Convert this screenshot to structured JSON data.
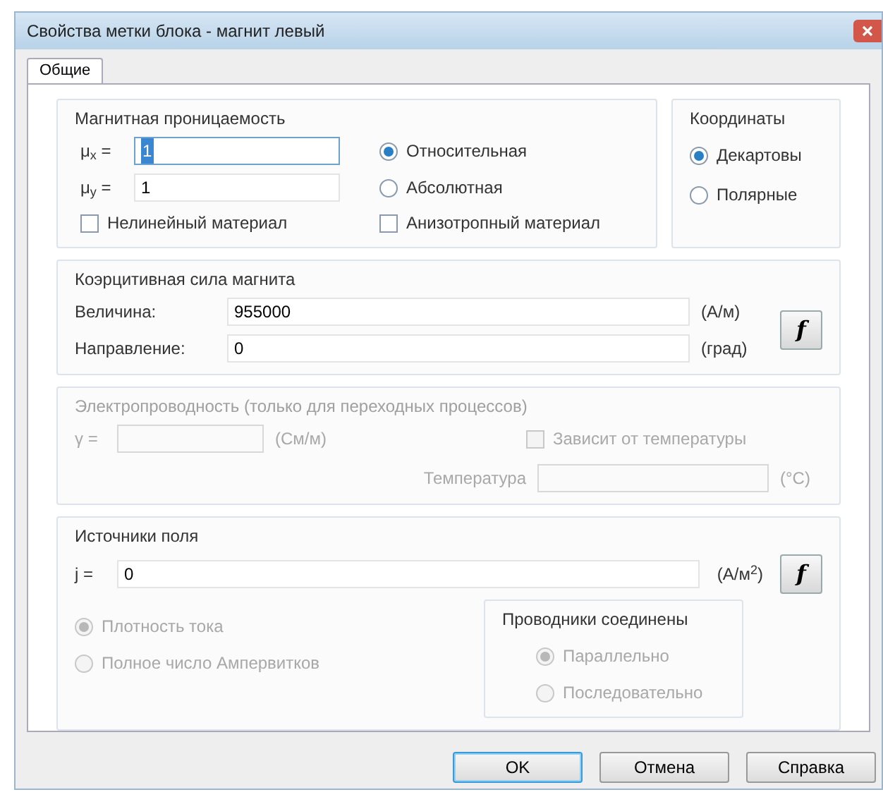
{
  "window": {
    "title": "Свойства метки блока - магнит левый"
  },
  "tabs": [
    {
      "label": "Общие",
      "selected": true
    }
  ],
  "permeability": {
    "title": "Магнитная проницаемость",
    "fields": [
      {
        "label": "μ$_{x}$ =",
        "value": "1",
        "focused": true
      },
      {
        "label": "μ$_{y}$ =",
        "value": "1",
        "focused": false
      }
    ],
    "radios": [
      {
        "label": "Относительная",
        "selected": true
      },
      {
        "label": "Абсолютная",
        "selected": false
      }
    ],
    "checkboxes": [
      {
        "label": "Нелинейный материал",
        "checked": false
      },
      {
        "label": "Анизотропный материал",
        "checked": false
      }
    ]
  },
  "coordinates": {
    "title": "Координаты",
    "radios": [
      {
        "label": "Декартовы",
        "selected": true
      },
      {
        "label": "Полярные",
        "selected": false
      }
    ]
  },
  "coercive": {
    "title": "Коэрцитивная сила магнита",
    "rows": [
      {
        "label": "Величина:",
        "value": "955000",
        "unit": "(А/м)"
      },
      {
        "label": "Направление:",
        "value": "0",
        "unit": "(град)"
      }
    ],
    "function_button": "f"
  },
  "conductivity": {
    "title": "Электропроводность (только для переходных процессов)",
    "disabled": true,
    "field": {
      "label": "γ =",
      "unit": "(См/м)"
    },
    "checkbox": {
      "label": "Зависит от температуры",
      "checked": false
    },
    "temperature": {
      "label": "Температура",
      "unit": "(°C)"
    }
  },
  "sources": {
    "title": "Источники поля",
    "field": {
      "label": "j =",
      "value": "0",
      "unit": "(А/м$^{2}$)"
    },
    "function_button": "f",
    "radios": [
      {
        "label": "Плотность тока",
        "selected": true,
        "disabled": true
      },
      {
        "label": "Полное число Ампервитков",
        "selected": false,
        "disabled": true
      }
    ],
    "connection": {
      "title": "Проводники соединены",
      "disabled": true,
      "radios": [
        {
          "label": "Параллельно",
          "selected": true
        },
        {
          "label": "Последовательно",
          "selected": false
        }
      ]
    }
  },
  "buttons": [
    {
      "label": "OK",
      "default": true
    },
    {
      "label": "Отмена",
      "default": false
    },
    {
      "label": "Справка",
      "default": false
    }
  ]
}
